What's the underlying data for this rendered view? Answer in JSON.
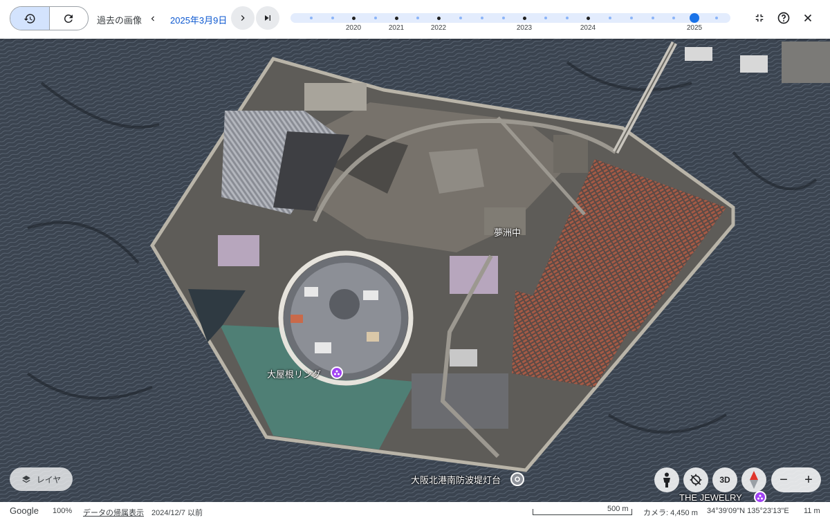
{
  "toolbar": {
    "history_icon": "history-icon",
    "refresh_icon": "refresh-icon",
    "past_images_label": "過去の画像",
    "current_date": "2025年3月9日",
    "timeline_years": [
      "2020",
      "2021",
      "2022",
      "2023",
      "2024",
      "2025"
    ],
    "selected_year": "2025",
    "collapse_icon": "collapse-icon",
    "help_icon": "help-icon",
    "close_icon": "close-icon"
  },
  "map": {
    "labels": {
      "yumeshima": "夢洲中",
      "ring": "大屋根リング",
      "lighthouse": "大阪北港南防波堤灯台",
      "jewelry": "THE JEWELRY"
    },
    "layer_button": "レイヤ",
    "view_3d": "3D",
    "zoom_out": "−",
    "zoom_in": "+"
  },
  "footer": {
    "brand": "Google",
    "zoom_level": "100%",
    "attribution_link": "データの帰属表示",
    "imagery_date": "2024/12/7 以前",
    "scale_label": "500 m",
    "camera": "カメラ: 4,450 m",
    "coordinates": "34°39'09\"N 135°23'13\"E",
    "altitude": "11 m"
  },
  "colors": {
    "accent": "#0b57d0",
    "timeline_thumb": "#1a73e8",
    "poi_pin": "#a142f4"
  }
}
